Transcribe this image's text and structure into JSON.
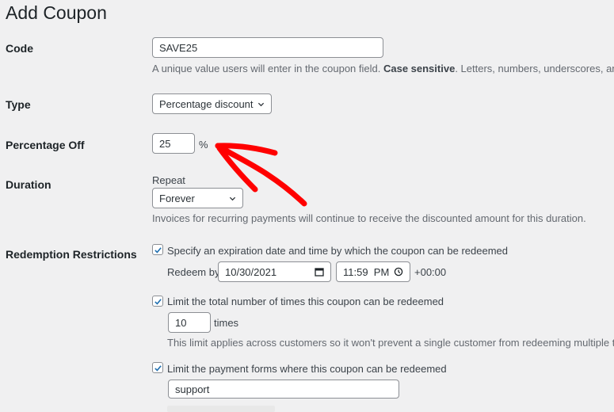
{
  "page": {
    "title": "Add Coupon"
  },
  "code": {
    "label": "Code",
    "value": "SAVE25",
    "help_prefix": "A unique value users will enter in the coupon field. ",
    "help_bold": "Case sensitive",
    "help_suffix": ". Letters, numbers, underscores, and dashes"
  },
  "type": {
    "label": "Type",
    "selected": "Percentage discount"
  },
  "percentage_off": {
    "label": "Percentage Off",
    "value": "25",
    "unit": "%"
  },
  "duration": {
    "label": "Duration",
    "repeat_label": "Repeat",
    "selected": "Forever",
    "help": "Invoices for recurring payments will continue to receive the discounted amount for this duration."
  },
  "redemption": {
    "label": "Redemption Restrictions",
    "expiration": {
      "checked": true,
      "label": "Specify an expiration date and time by which the coupon can be redeemed",
      "redeem_by_label": "Redeem by",
      "date": "10/30/2021",
      "time": "11:59  PM",
      "timezone": "+00:00"
    },
    "limit_total": {
      "checked": true,
      "label": "Limit the total number of times this coupon can be redeemed",
      "value": "10",
      "unit": "times",
      "help": "This limit applies across customers so it won't prevent a single customer from redeeming multiple times."
    },
    "limit_forms": {
      "checked": true,
      "label": "Limit the payment forms where this coupon can be redeemed",
      "value": "support"
    }
  },
  "annotation": {
    "arrow_color": "#ff0000"
  }
}
